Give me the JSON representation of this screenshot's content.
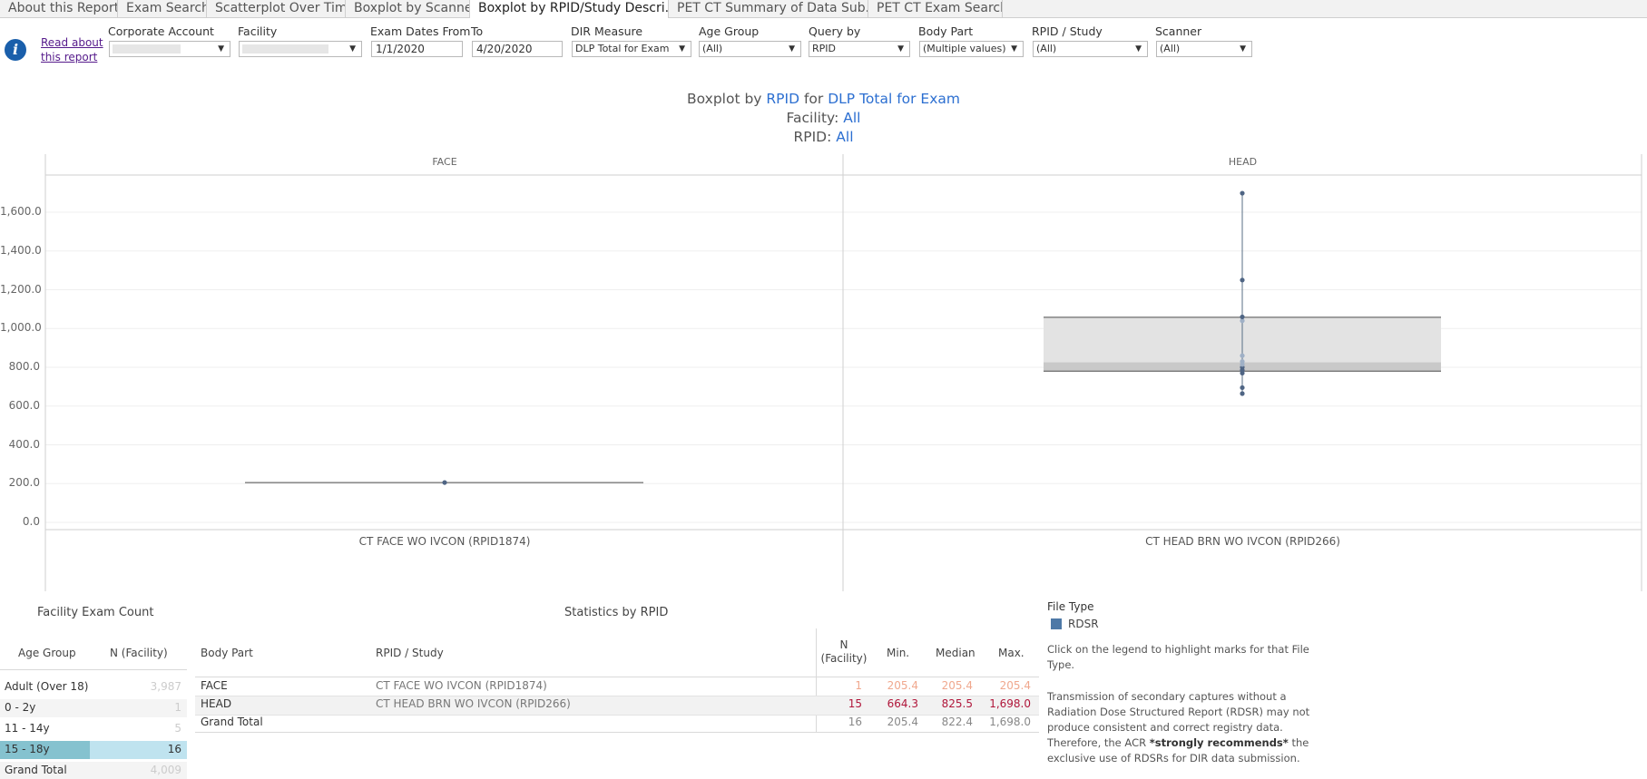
{
  "tabs": [
    "About this Report",
    "Exam Search",
    "Scatterplot Over Time",
    "Boxplot by Scanner",
    "Boxplot by RPID/Study Descri...",
    "PET CT Summary of Data Sub...",
    "PET CT Exam Search"
  ],
  "read_link": "Read about this report",
  "filters": {
    "corporate_account": {
      "label": "Corporate Account",
      "value": ""
    },
    "facility": {
      "label": "Facility",
      "value": ""
    },
    "exam_dates_from": {
      "label": "Exam Dates From",
      "value": "1/1/2020"
    },
    "to": {
      "label": "To",
      "value": "4/20/2020"
    },
    "dir_measure": {
      "label": "DIR Measure",
      "value": "DLP Total for Exam"
    },
    "age_group": {
      "label": "Age Group",
      "value": "(All)"
    },
    "query_by": {
      "label": "Query by",
      "value": "RPID"
    },
    "body_part": {
      "label": "Body Part",
      "value": "(Multiple values)"
    },
    "rpid_study": {
      "label": "RPID / Study",
      "value": "(All)"
    },
    "scanner": {
      "label": "Scanner",
      "value": "(All)"
    }
  },
  "chart_title": {
    "line1_prefix": "Boxplot by",
    "line1_query": "RPID",
    "line1_for": "for",
    "line1_measure": "DLP Total for Exam",
    "line2_label": "Facility:",
    "line2_value": "All",
    "line3_label": "RPID:",
    "line3_value": "All"
  },
  "chart_data": {
    "type": "boxplot",
    "ylim": [
      0,
      1800
    ],
    "yticks": [
      "0.0",
      "200.0",
      "400.0",
      "600.0",
      "800.0",
      "1,000.0",
      "1,200.0",
      "1,400.0",
      "1,600.0"
    ],
    "ytick_values": [
      0,
      200,
      400,
      600,
      800,
      1000,
      1200,
      1400,
      1600
    ],
    "panels": [
      {
        "header": "FACE",
        "category": "CT FACE WO IVCON (RPID1874)",
        "points": [
          205.4
        ],
        "min": 205.4,
        "q1": 205.4,
        "median": 205.4,
        "q3": 205.4,
        "max": 205.4
      },
      {
        "header": "HEAD",
        "category": "CT HEAD BRN WO IVCON (RPID266)",
        "points": [
          664.3,
          695,
          770,
          785,
          800,
          815,
          830,
          860,
          1040,
          1060,
          1250,
          1698.0
        ],
        "min": 664.3,
        "q1": 780,
        "median": 825.5,
        "q3": 1058,
        "max": 1698.0
      }
    ]
  },
  "facility_count": {
    "title": "Facility Exam Count",
    "col_age": "Age Group",
    "col_n": "N (Facility)",
    "rows": [
      {
        "age": "Adult (Over 18)",
        "n": "3,987"
      },
      {
        "age": "0 - 2y",
        "n": "1"
      },
      {
        "age": "11 - 14y",
        "n": "5"
      },
      {
        "age": "15 - 18y",
        "n": "16"
      },
      {
        "age": "Grand Total",
        "n": "4,009"
      }
    ]
  },
  "stats": {
    "title": "Statistics by RPID",
    "col_body": "Body Part",
    "col_rpid": "RPID / Study",
    "col_n": "N (Facility)",
    "col_min": "Min.",
    "col_median": "Median",
    "col_max": "Max.",
    "rows": [
      {
        "body": "FACE",
        "rpid": "CT FACE WO IVCON (RPID1874)",
        "n": "1",
        "min": "205.4",
        "median": "205.4",
        "max": "205.4"
      },
      {
        "body": "HEAD",
        "rpid": "CT HEAD BRN WO IVCON (RPID266)",
        "n": "15",
        "min": "664.3",
        "median": "825.5",
        "max": "1,698.0"
      },
      {
        "body": "Grand Total",
        "rpid": "",
        "n": "16",
        "min": "205.4",
        "median": "822.4",
        "max": "1,698.0"
      }
    ]
  },
  "legend": {
    "title": "File Type",
    "item": "RDSR",
    "color": "#4e79a7",
    "note1": "Click on the legend to highlight marks for that File Type.",
    "note2_a": "Transmission of secondary captures without a Radiation Dose Structured Report (RDSR) may not produce consistent and correct registry data. Therefore, the ACR ",
    "note2_b": "*strongly recommends*",
    "note2_c": " the exclusive use of RDSRs for DIR data submission."
  }
}
